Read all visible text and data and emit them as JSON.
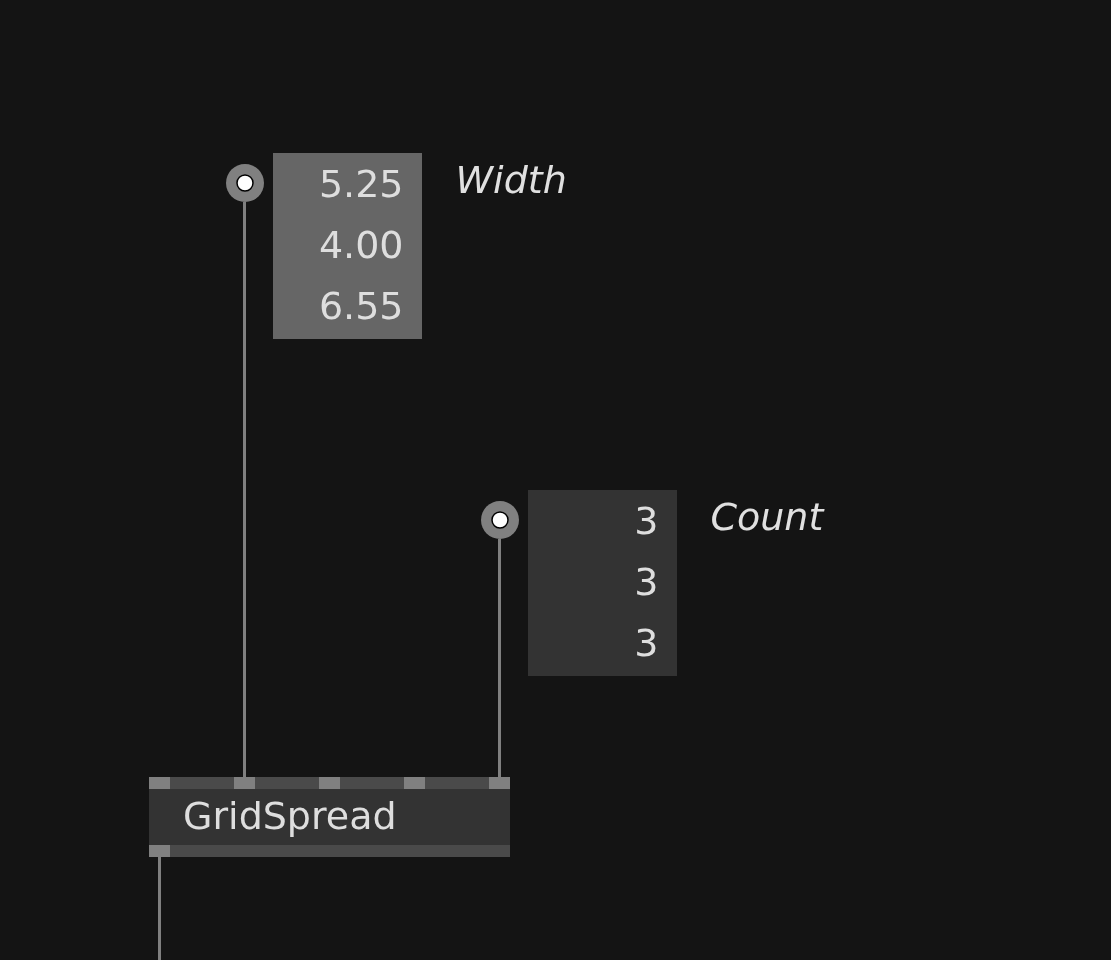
{
  "ioboxes": [
    {
      "label": "Width",
      "selected": true,
      "values": [
        "5.25",
        "4.00",
        "6.55"
      ]
    },
    {
      "label": "Count",
      "selected": false,
      "values": [
        "3",
        "3",
        "3"
      ]
    }
  ],
  "node": {
    "title": "GridSpread"
  }
}
